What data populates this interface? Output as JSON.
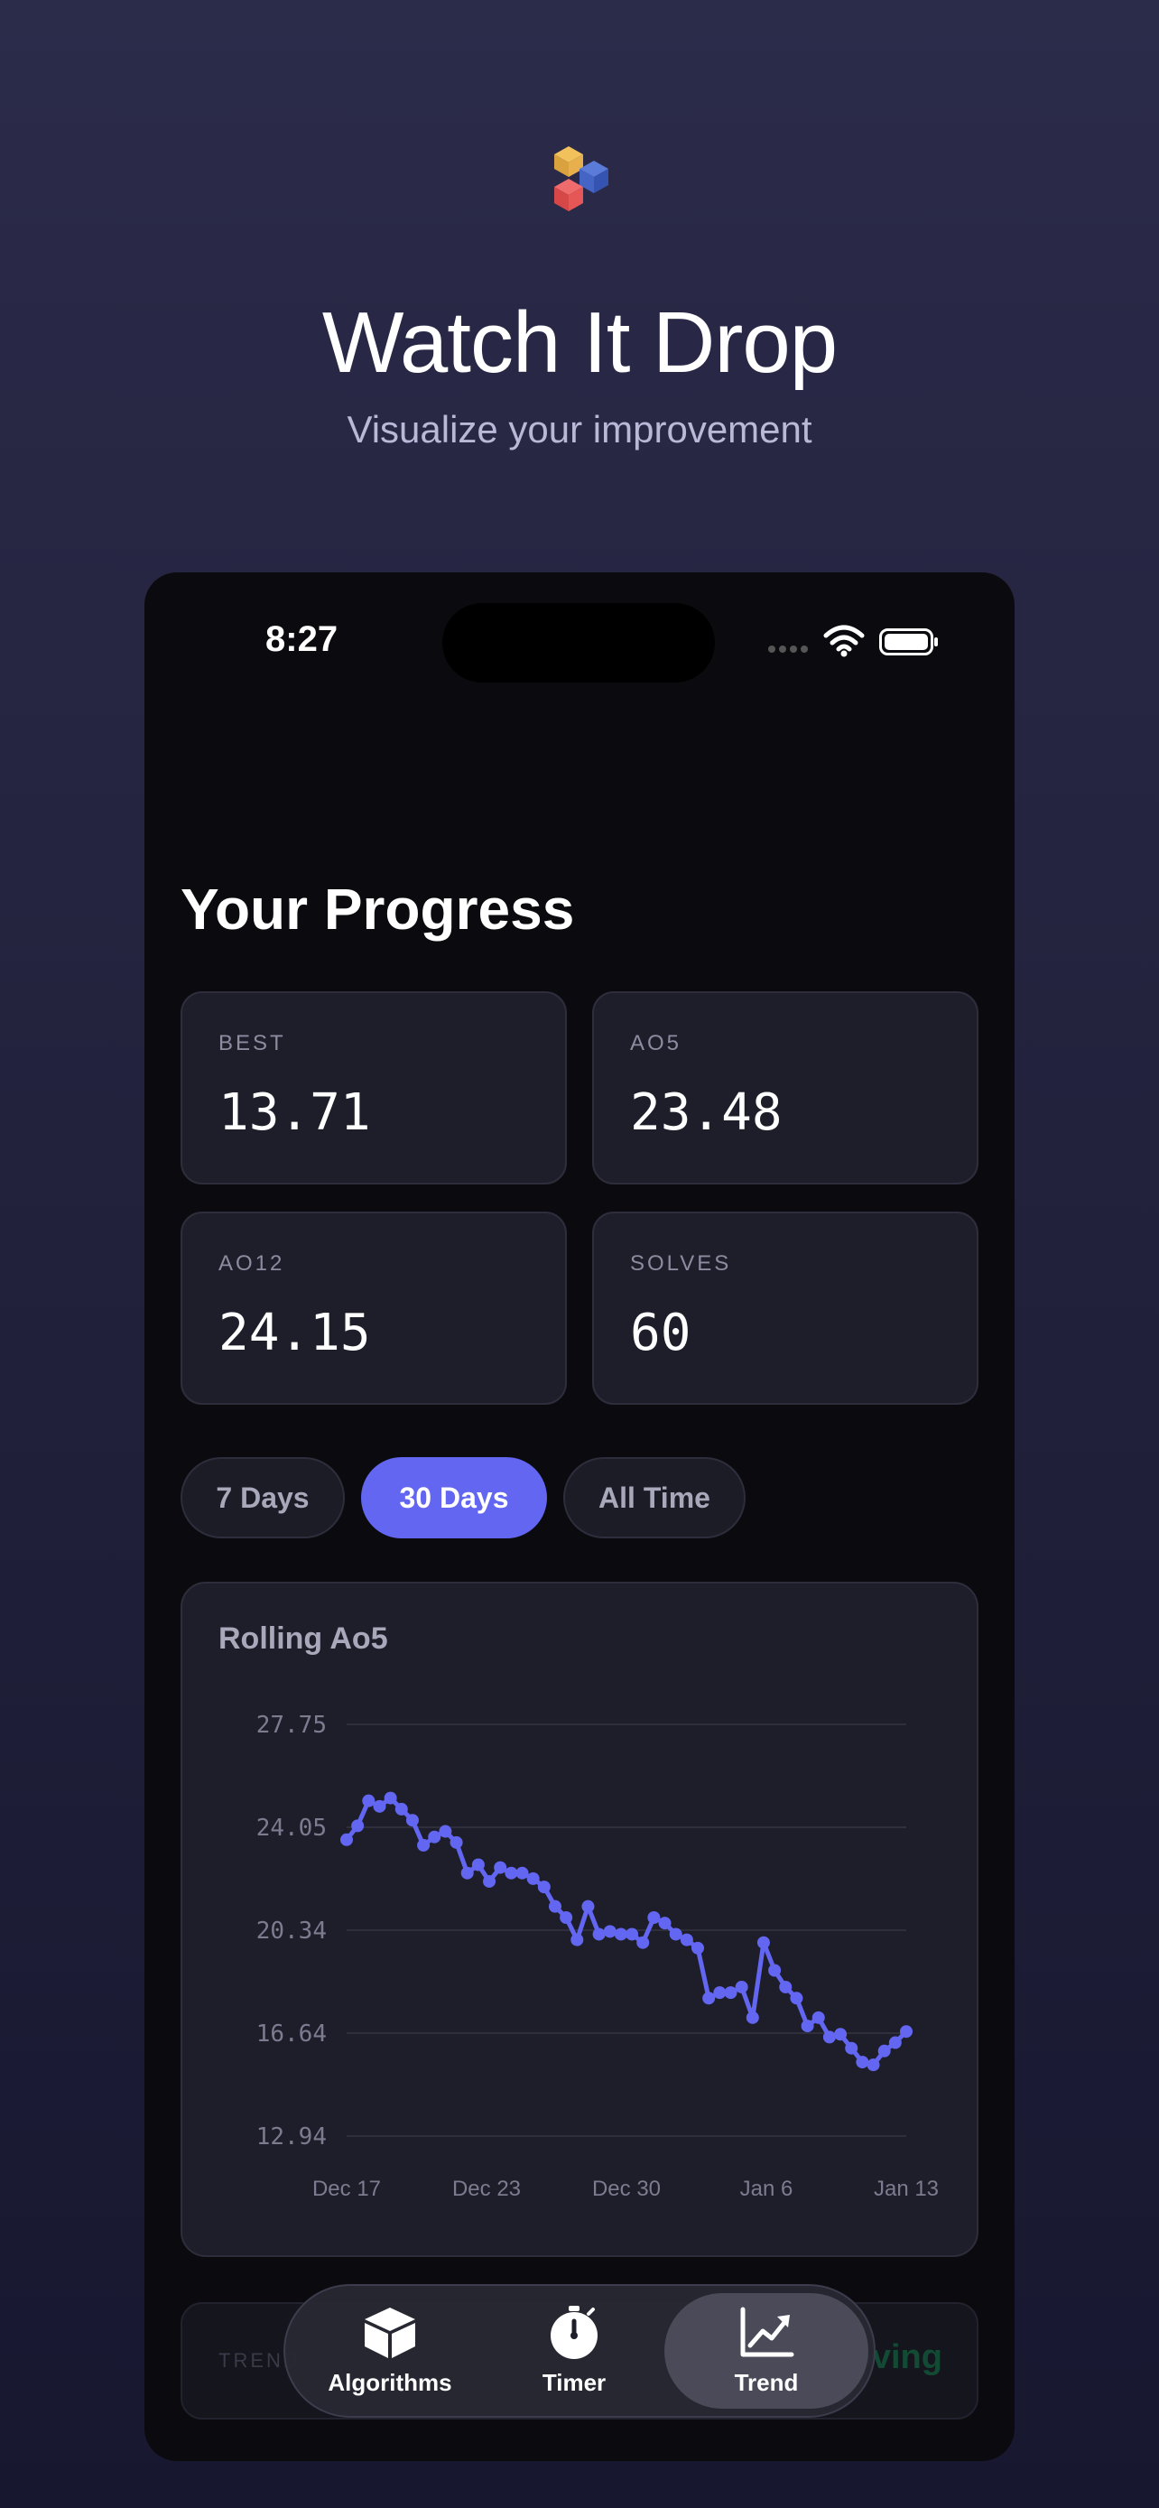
{
  "hero": {
    "title": "Watch It Drop",
    "subtitle": "Visualize your improvement"
  },
  "status_bar": {
    "time": "8:27"
  },
  "screen": {
    "title": "Your Progress"
  },
  "stats": [
    {
      "label": "BEST",
      "value": "13.71"
    },
    {
      "label": "AO5",
      "value": "23.48"
    },
    {
      "label": "AO12",
      "value": "24.15"
    },
    {
      "label": "SOLVES",
      "value": "60"
    }
  ],
  "ranges": {
    "options": [
      "7 Days",
      "30 Days",
      "All Time"
    ],
    "selected": "30 Days"
  },
  "chart_data": {
    "type": "line",
    "title": "Rolling Ao5",
    "xlabel": "",
    "ylabel": "",
    "y_ticks": [
      "27.75",
      "24.05",
      "20.34",
      "16.64",
      "12.94"
    ],
    "x_ticks": [
      "Dec 17",
      "Dec 23",
      "Dec 30",
      "Jan 6",
      "Jan 13"
    ],
    "ylim": [
      12.94,
      27.75
    ],
    "grid": true,
    "color": "#6366f1",
    "series": [
      {
        "values": [
          23.6,
          24.1,
          25.0,
          24.8,
          25.1,
          24.7,
          24.3,
          23.4,
          23.7,
          23.9,
          23.5,
          22.4,
          22.7,
          22.1,
          22.6,
          22.4,
          22.4,
          22.2,
          21.9,
          21.2,
          20.8,
          20.0,
          21.2,
          20.2,
          20.3,
          20.2,
          20.2,
          19.9,
          20.8,
          20.6,
          20.2,
          20.0,
          19.7,
          17.9,
          18.1,
          18.1,
          18.3,
          17.2,
          19.9,
          18.9,
          18.3,
          17.9,
          16.9,
          17.2,
          16.5,
          16.6,
          16.1,
          15.6,
          15.5,
          16.0,
          16.3,
          16.7
        ]
      }
    ]
  },
  "trend_card": {
    "label": "TREND",
    "status": "Improving"
  },
  "tab_bar": {
    "items": [
      "Algorithms",
      "Timer",
      "Trend"
    ],
    "active": "Trend"
  },
  "colors": {
    "accent": "#6366f1",
    "background_top": "#2b2b4a",
    "phone_bg": "#0b0b0f",
    "card_bg": "#1e1e2b"
  },
  "icons": {
    "logo": "cube-logo",
    "algorithms": "cube-icon",
    "timer": "stopwatch-icon",
    "trend": "trend-chart-icon"
  }
}
